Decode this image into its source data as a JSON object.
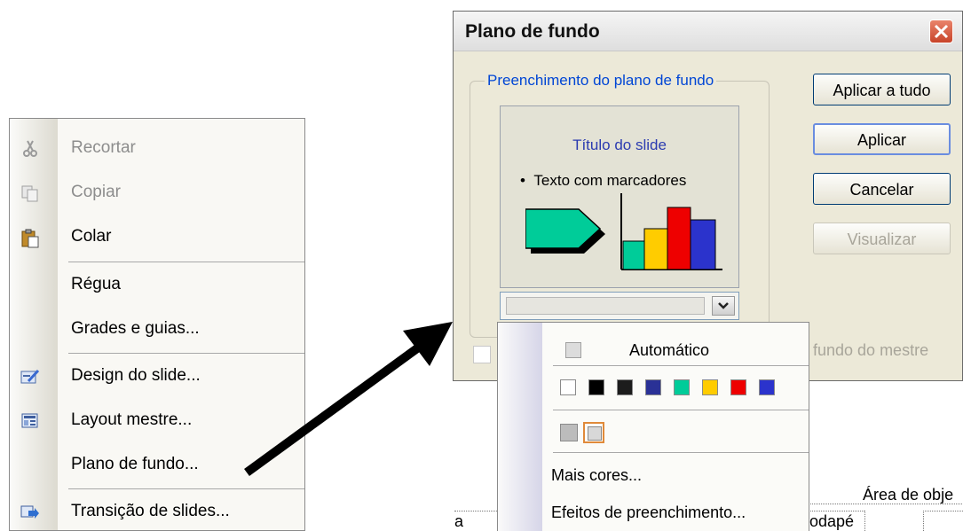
{
  "context_menu": {
    "items": [
      {
        "label": "Recortar",
        "icon": "scissors-icon",
        "enabled": false
      },
      {
        "label": "Copiar",
        "icon": "copy-icon",
        "enabled": false
      },
      {
        "label": "Colar",
        "icon": "paste-icon",
        "enabled": true
      },
      {
        "label": "Régua",
        "icon": "",
        "enabled": true
      },
      {
        "label": "Grades e guias...",
        "icon": "",
        "enabled": true
      },
      {
        "label": "Design do slide...",
        "icon": "slide-design-icon",
        "enabled": true
      },
      {
        "label": "Layout mestre...",
        "icon": "master-layout-icon",
        "enabled": true
      },
      {
        "label": "Plano de fundo...",
        "icon": "",
        "enabled": true
      },
      {
        "label": "Transição de slides...",
        "icon": "slide-transition-icon",
        "enabled": true
      }
    ]
  },
  "dialog": {
    "title": "Plano de fundo",
    "group_label": "Preenchimento do plano de fundo",
    "preview": {
      "slide_title": "Título do slide",
      "bullet_text": "Texto com marcadores"
    },
    "buttons": {
      "apply_all": "Aplicar a tudo",
      "apply": "Aplicar",
      "cancel": "Cancelar",
      "preview": "Visualizar"
    },
    "omit_master_partial": "fundo do mestre"
  },
  "slide_area": {
    "object_area_partial": "Área de obje",
    "footer_partial": "odapé",
    "left_partial": "a"
  },
  "color_dropdown": {
    "automatic_label": "Automático",
    "colors": [
      "#ffffff",
      "#000000",
      "#1c1c1c",
      "#2a3196",
      "#00cc99",
      "#ffcc00",
      "#ee0000",
      "#2b33cc"
    ],
    "recent_colors": [
      "#bcbcbc",
      "#d8d8d8"
    ],
    "more_colors": "Mais cores...",
    "fill_effects": "Efeitos de preenchimento..."
  }
}
